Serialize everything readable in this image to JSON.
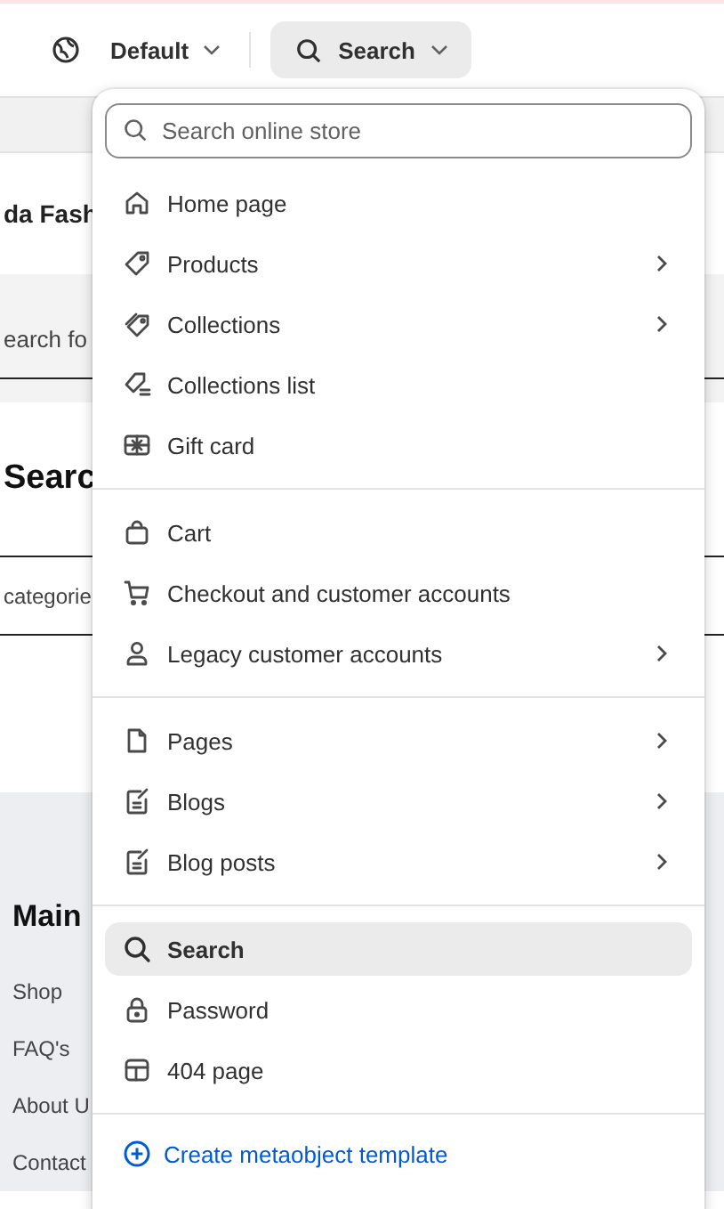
{
  "header": {
    "theme_selector": {
      "label": "Default"
    },
    "template_button": {
      "label": "Search",
      "active": true
    }
  },
  "preview": {
    "store_title": {
      "left": "da Fash"
    },
    "search_field": {
      "text": "earch fo"
    },
    "page_heading": {
      "left": "Searc"
    },
    "filter_label": "categorie",
    "footer": {
      "heading_left": "Main",
      "links": [
        {
          "left": "Shop"
        },
        {
          "left": "FAQ's"
        },
        {
          "left": "About U"
        },
        {
          "left": "Contact"
        }
      ]
    }
  },
  "search": {
    "placeholder": "Search online store"
  },
  "menu_groups": [
    {
      "items": [
        {
          "label": "Home page",
          "submenu": false,
          "selected": false
        },
        {
          "label": "Products",
          "submenu": true,
          "selected": false
        },
        {
          "label": "Collections",
          "submenu": true,
          "selected": false
        },
        {
          "label": "Collections list",
          "submenu": false,
          "selected": false
        },
        {
          "label": "Gift card",
          "submenu": false,
          "selected": false
        }
      ]
    },
    {
      "items": [
        {
          "label": "Cart",
          "submenu": false,
          "selected": false
        },
        {
          "label": "Checkout and customer accounts",
          "submenu": false,
          "selected": false
        },
        {
          "label": "Legacy customer accounts",
          "submenu": true,
          "selected": false
        }
      ]
    },
    {
      "items": [
        {
          "label": "Pages",
          "submenu": true,
          "selected": false
        },
        {
          "label": "Blogs",
          "submenu": true,
          "selected": false
        },
        {
          "label": "Blog posts",
          "submenu": true,
          "selected": false
        }
      ]
    },
    {
      "items": [
        {
          "label": "Search",
          "submenu": false,
          "selected": true
        },
        {
          "label": "Password",
          "submenu": false,
          "selected": false
        },
        {
          "label": "404 page",
          "submenu": false,
          "selected": false
        }
      ]
    }
  ],
  "create_link": {
    "label": "Create metaobject template"
  }
}
